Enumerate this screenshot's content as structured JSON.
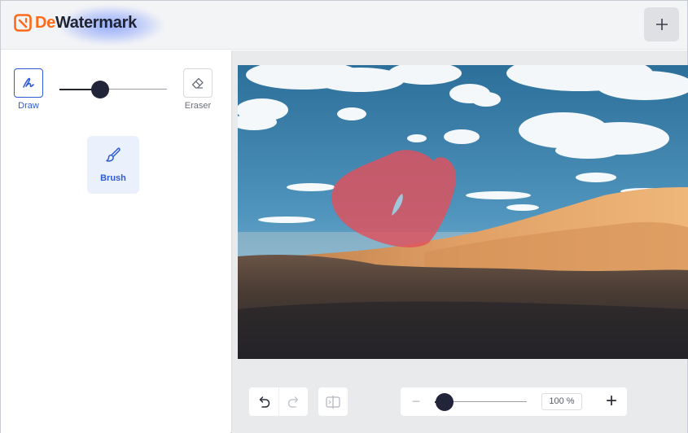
{
  "app": {
    "logo_part1": "De",
    "logo_part2": "Watermark",
    "brand_color": "#ff6a1a",
    "accent_color": "#2f5bd6",
    "add_icon": "plus-icon"
  },
  "tools": {
    "draw_label": "Draw",
    "eraser_label": "Eraser",
    "brush_label": "Brush",
    "draw_icon": "pen-scribble-icon",
    "eraser_icon": "eraser-icon",
    "brush_icon": "paintbrush-icon",
    "brush_size_fraction": 0.38
  },
  "canvas": {
    "image_alt": "desert dunes under blue sky with clouds",
    "mask_color": "#e0515b"
  },
  "toolbar": {
    "undo_icon": "undo-icon",
    "redo_icon": "redo-icon",
    "compare_icon": "compare-split-icon",
    "zoom_minus": "−",
    "zoom_plus": "+",
    "zoom_value": "100 %",
    "zoom_fraction": 0.05
  }
}
